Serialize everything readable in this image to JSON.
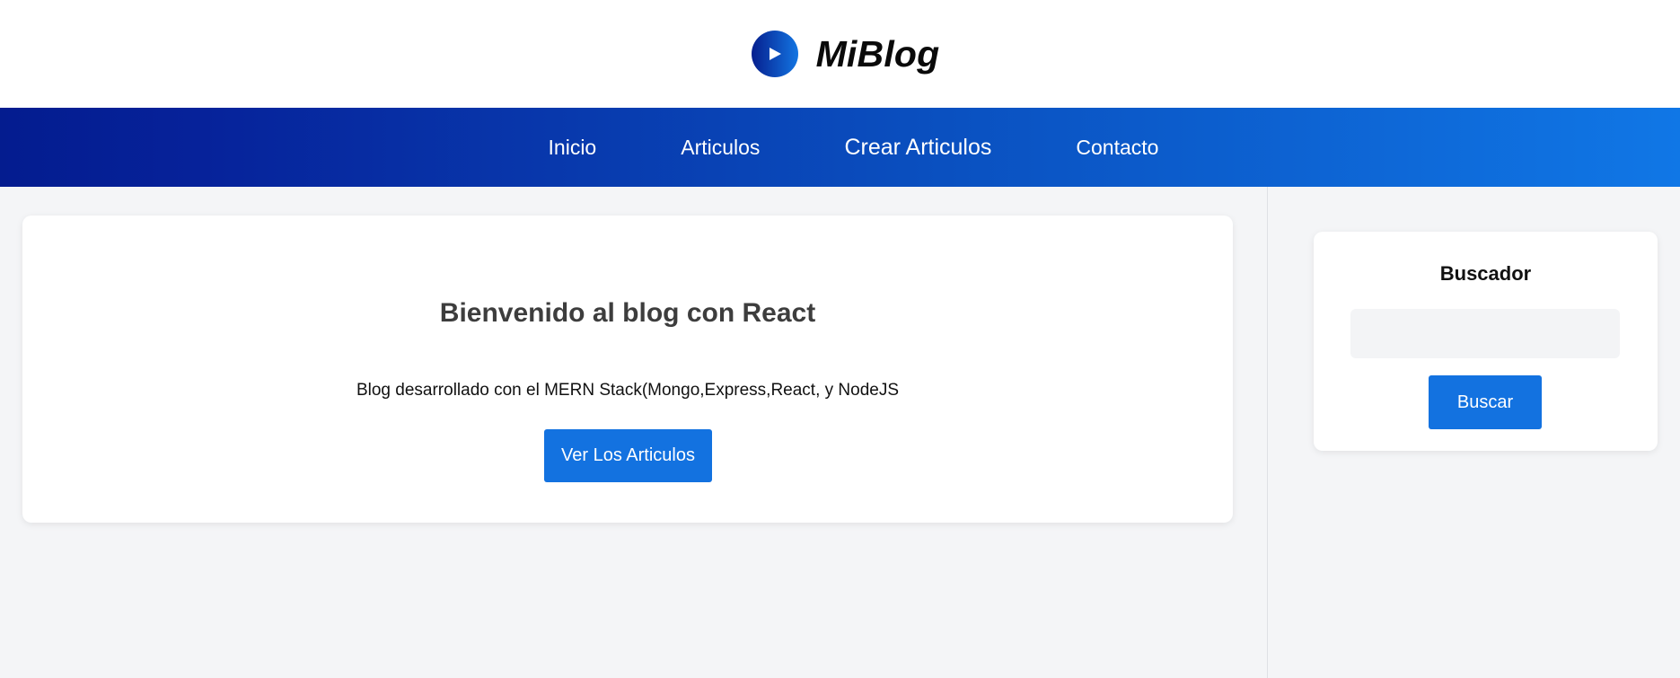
{
  "header": {
    "logo_icon": "play-circle-icon",
    "title": "MiBlog"
  },
  "nav": {
    "items": [
      {
        "label": "Inicio"
      },
      {
        "label": "Articulos"
      },
      {
        "label": "Crear Articulos"
      },
      {
        "label": "Contacto"
      }
    ]
  },
  "hero": {
    "title": "Bienvenido al blog con React",
    "subtitle": "Blog desarrollado con el MERN Stack(Mongo,Express,React, y NodeJS",
    "button_label": "Ver Los Articulos"
  },
  "sidebar": {
    "search_title": "Buscador",
    "search_value": "",
    "search_button_label": "Buscar"
  },
  "colors": {
    "accent": "#1372e0",
    "nav_gradient_start": "#041c8f",
    "nav_gradient_end": "#1077e6",
    "background": "#f4f5f7"
  }
}
